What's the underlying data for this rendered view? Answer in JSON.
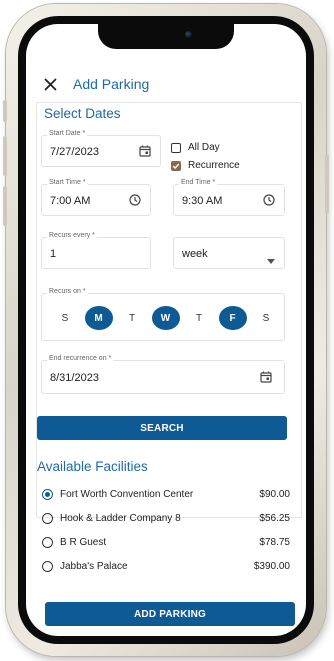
{
  "header": {
    "title": "Add Parking"
  },
  "form": {
    "section_title": "Select Dates",
    "start_date": {
      "label": "Start Date *",
      "value": "7/27/2023"
    },
    "all_day": {
      "label": "All Day",
      "checked": false
    },
    "recurrence": {
      "label": "Recurrence",
      "checked": true
    },
    "start_time": {
      "label": "Start Time *",
      "value": "7:00 AM"
    },
    "end_time": {
      "label": "End Time *",
      "value": "9:30 AM"
    },
    "recurs_every": {
      "label": "Recurs every *",
      "value": "1"
    },
    "period": {
      "value": "week"
    },
    "recurs_on": {
      "label": "Recurs on *",
      "days": [
        {
          "label": "S",
          "selected": false
        },
        {
          "label": "M",
          "selected": true
        },
        {
          "label": "T",
          "selected": false
        },
        {
          "label": "W",
          "selected": true
        },
        {
          "label": "T",
          "selected": false
        },
        {
          "label": "F",
          "selected": true
        },
        {
          "label": "S",
          "selected": false
        }
      ]
    },
    "end_recurrence": {
      "label": "End recurrence on *",
      "value": "8/31/2023"
    },
    "search_label": "SEARCH"
  },
  "facilities": {
    "title": "Available Facilities",
    "items": [
      {
        "name": "Fort Worth Convention Center",
        "price": "$90.00",
        "selected": true
      },
      {
        "name": "Hook & Ladder Company 8",
        "price": "$56.25",
        "selected": false
      },
      {
        "name": "B R Guest",
        "price": "$78.75",
        "selected": false
      },
      {
        "name": "Jabba's Palace",
        "price": "$390.00",
        "selected": false
      }
    ]
  },
  "add_parking_label": "ADD PARKING",
  "colors": {
    "accent": "#0d5a94",
    "title": "#1f6aa6",
    "checkbox": "#8a6a4b"
  },
  "icons": {
    "close": "close-icon",
    "calendar": "calendar-icon",
    "clock": "clock-icon",
    "dropdown": "chevron-down-icon"
  }
}
